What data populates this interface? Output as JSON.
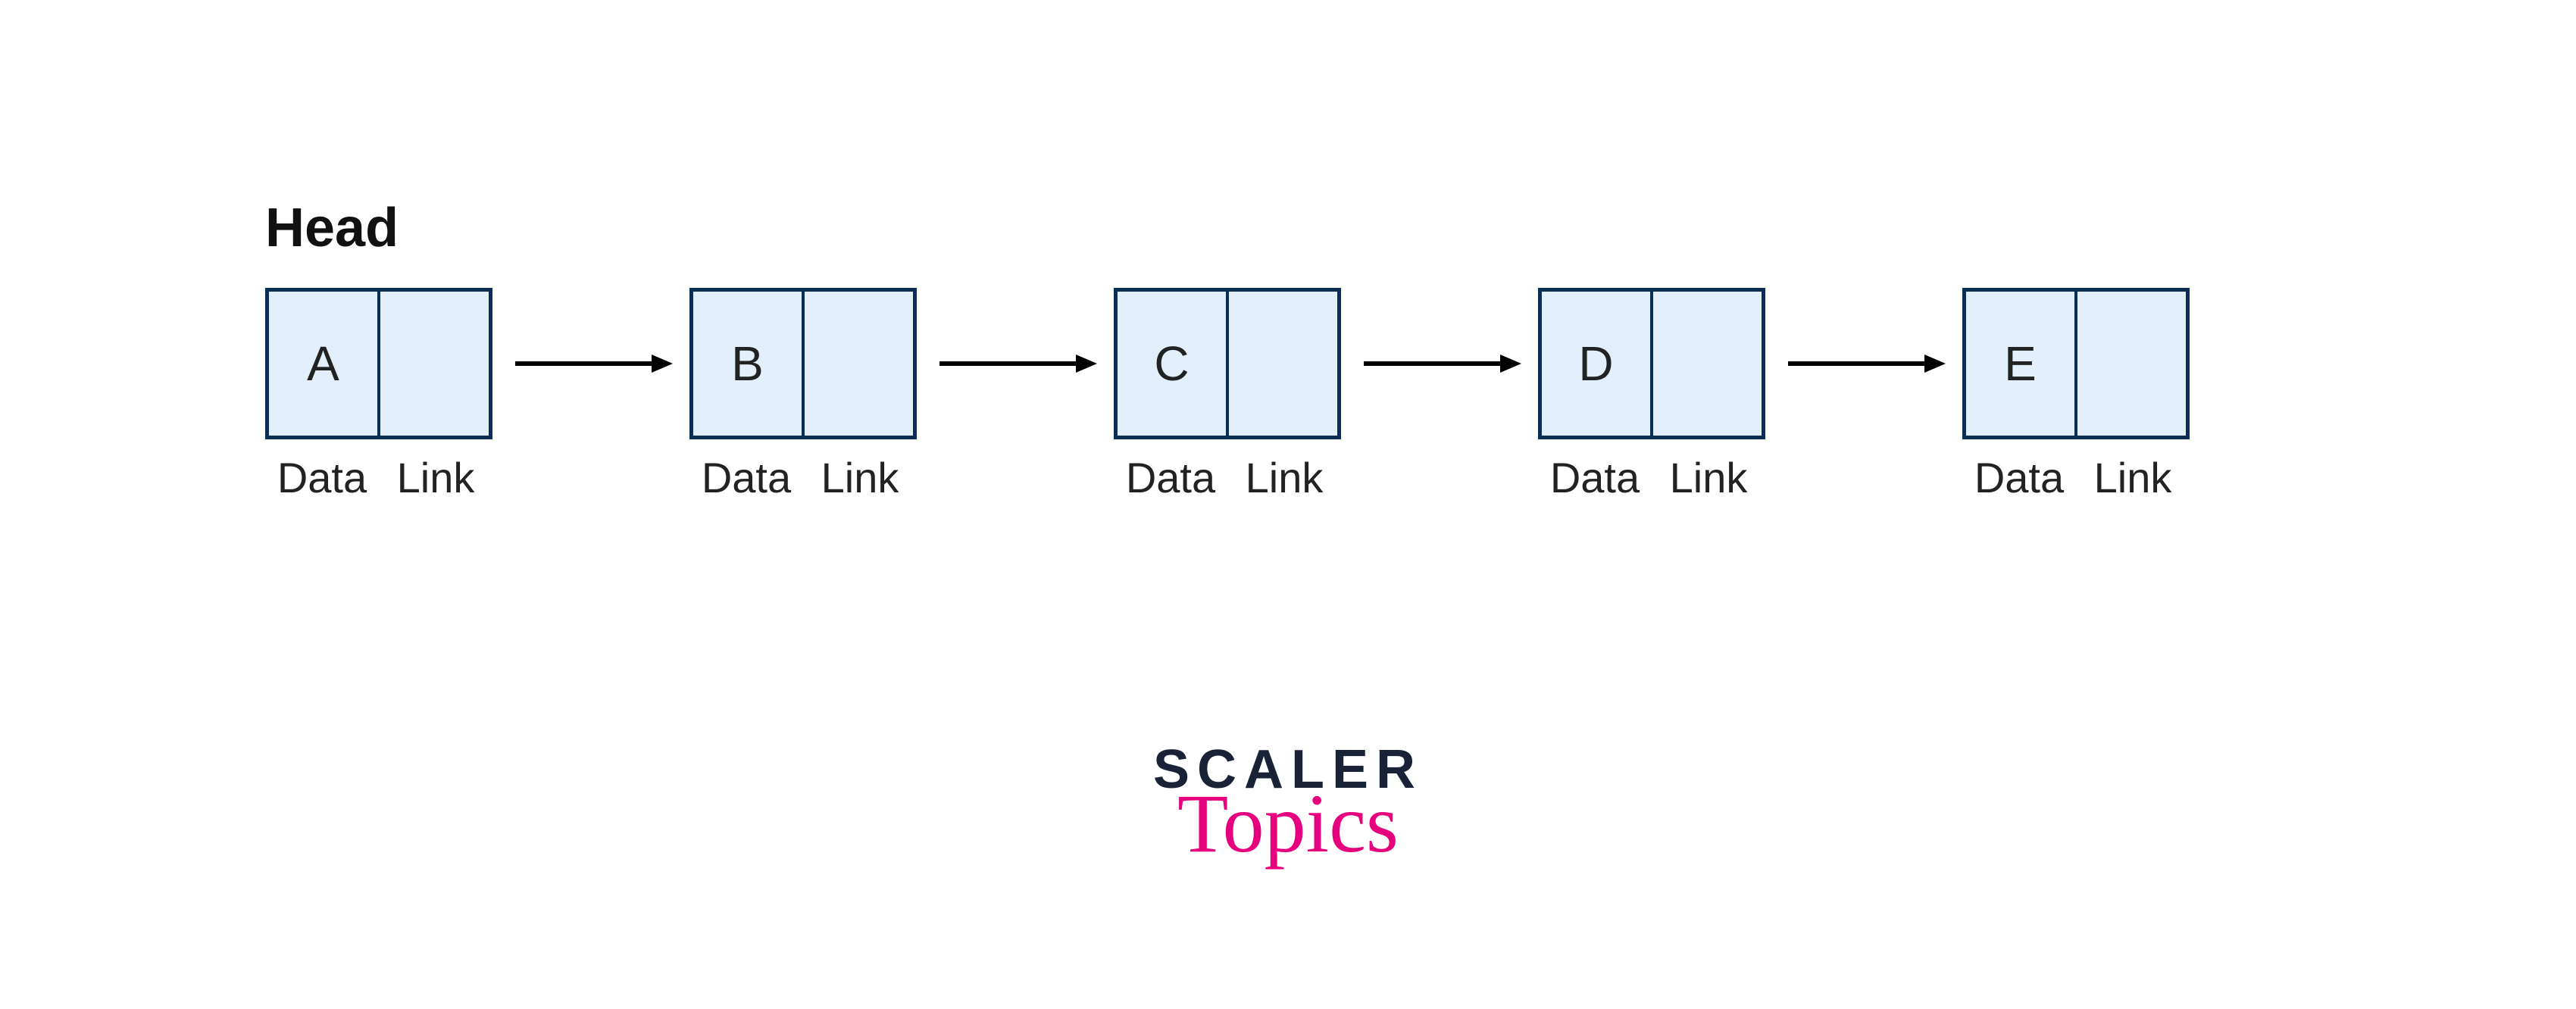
{
  "head_label": "Head",
  "field_labels": {
    "data": "Data",
    "link": "Link"
  },
  "nodes": [
    {
      "data": "A"
    },
    {
      "data": "B"
    },
    {
      "data": "C"
    },
    {
      "data": "D"
    },
    {
      "data": "E"
    }
  ],
  "logo": {
    "line1": "SCALER",
    "line2": "Topics"
  },
  "colors": {
    "node_fill": "#e3f0fb",
    "node_border": "#0b2e55",
    "arrow": "#000000",
    "logo_text": "#1a2238",
    "logo_accent": "#e6007e"
  }
}
